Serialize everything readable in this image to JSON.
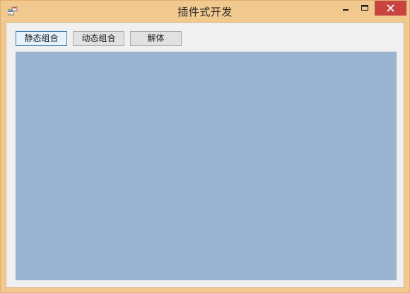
{
  "window": {
    "title": "插件式开发",
    "icon": "winforms-app-icon",
    "controls": {
      "minimize_icon": "minimize-icon",
      "maximize_icon": "maximize-icon",
      "close_icon": "close-icon"
    }
  },
  "toolbar": {
    "static_label": "静态组合",
    "dynamic_label": "动态组合",
    "dissolve_label": "解体"
  },
  "colors": {
    "titlebar": "#f1c98e",
    "client": "#f0f0f0",
    "panel": "#98b4d1",
    "close_button": "#c74440"
  }
}
